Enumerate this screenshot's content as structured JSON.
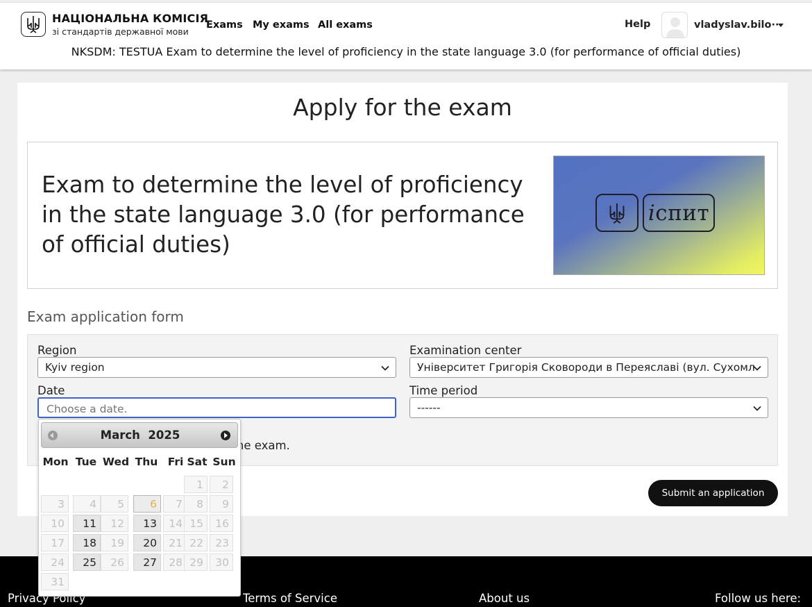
{
  "header": {
    "org_name": "НАЦІОНАЛЬНА КОМІСІЯ",
    "org_sub": "зі стандартів державної мови",
    "nav": [
      {
        "label": "Exams"
      },
      {
        "label": "My exams"
      },
      {
        "label": "All exams"
      }
    ],
    "help": "Help",
    "user_name": "vladyslav.bilo···",
    "exam_subtitle": "NKSDM: TESTUA Exam to determine the level of proficiency in the state language 3.0 (for performance of official duties)"
  },
  "main": {
    "page_title": "Apply for the exam",
    "exam_name": "Exam to determine the level of proficiency in the state language 3.0 (for performance of official duties)",
    "banner_word_italic": "і",
    "banner_word_rest": "спит",
    "form_heading": "Exam application form",
    "form": {
      "region_label": "Region",
      "region_value": "Kyiv region",
      "center_label": "Examination center",
      "center_value": "Університет Григорія Сковороди в Переяславі (вул. Сухомл",
      "date_label": "Date",
      "date_placeholder": "Choose a date.",
      "time_label": "Time period",
      "time_value": "------",
      "notice_tail": "e the exam."
    },
    "submit_label": "Submit an application"
  },
  "datepicker": {
    "month": "March",
    "year": "2025",
    "weekdays": [
      "Mon",
      "Tue",
      "Wed",
      "Thu",
      "Fri",
      "Sat",
      "Sun"
    ],
    "today": 6,
    "available_days": [
      11,
      13,
      18,
      20,
      25,
      27
    ]
  },
  "footer": {
    "privacy": "Privacy Policy",
    "terms": "Terms of Service",
    "about": "About us",
    "follow": "Follow us here:"
  },
  "colors": {
    "accent_border": "#3d63c8",
    "banner_blue": "#5272c2",
    "banner_yellow": "#f3f560",
    "today_text": "#e0b24a"
  }
}
